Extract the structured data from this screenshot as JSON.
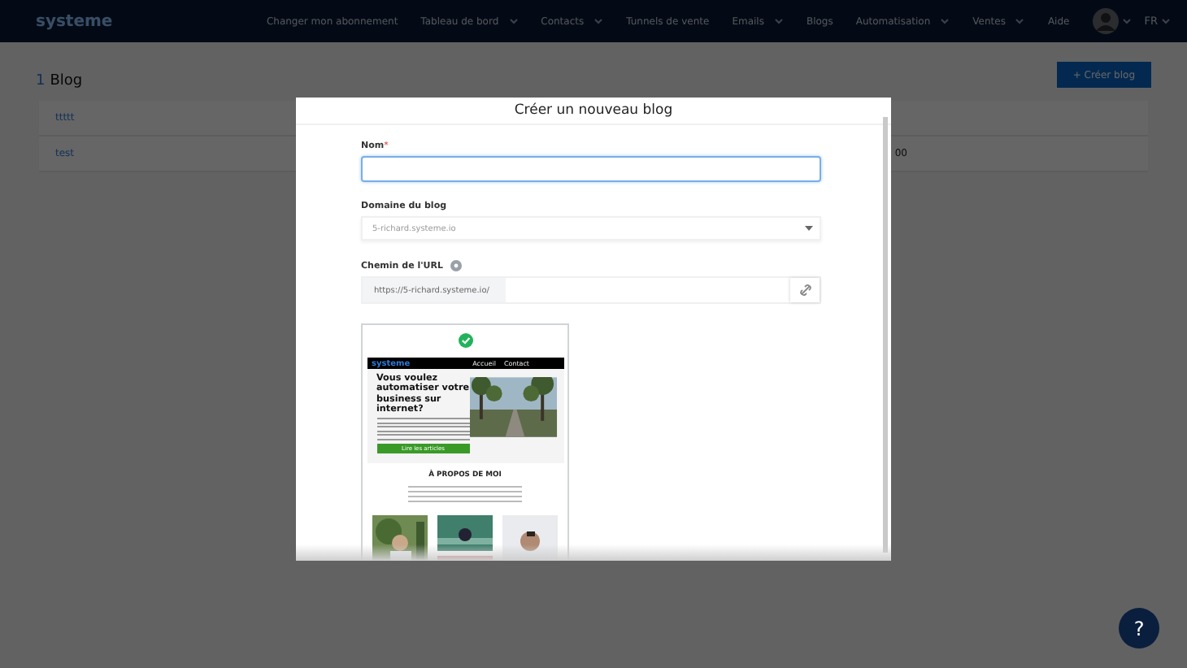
{
  "navbar": {
    "logo": "systeme",
    "items": [
      {
        "label": "Changer mon abonnement",
        "dropdown": false
      },
      {
        "label": "Tableau de bord",
        "dropdown": true
      },
      {
        "label": "Contacts",
        "dropdown": true
      },
      {
        "label": "Tunnels de vente",
        "dropdown": false
      },
      {
        "label": "Emails",
        "dropdown": true
      },
      {
        "label": "Blogs",
        "dropdown": false
      },
      {
        "label": "Automatisation",
        "dropdown": true
      },
      {
        "label": "Ventes",
        "dropdown": true
      },
      {
        "label": "Aide",
        "dropdown": false
      }
    ],
    "language": "FR"
  },
  "page": {
    "count": "1",
    "title": "Blog",
    "create_button": "+ Créer blog",
    "rows": [
      {
        "name": "ttttt",
        "column_2": ""
      },
      {
        "name": "test",
        "column_2": "00"
      }
    ]
  },
  "modal": {
    "title": "Créer un nouveau blog",
    "fields": [
      {
        "kind": "text",
        "label": "Nom",
        "required_mark": "*",
        "focused": true
      },
      {
        "kind": "select",
        "label": "Domaine du blog",
        "value": "5-richard.systeme.io"
      },
      {
        "kind": "url",
        "label": "Chemin de l'URL",
        "prefix": "https://5-richard.systeme.io/"
      }
    ],
    "template": {
      "selected": true,
      "logo": "systeme",
      "menu": [
        "Accueil",
        "Contact"
      ],
      "headline": "Vous voulez automatiser votre business sur internet?",
      "button": "Lire les articles",
      "section_title": "À PROPOS DE MOI"
    }
  },
  "help_button": "?"
}
